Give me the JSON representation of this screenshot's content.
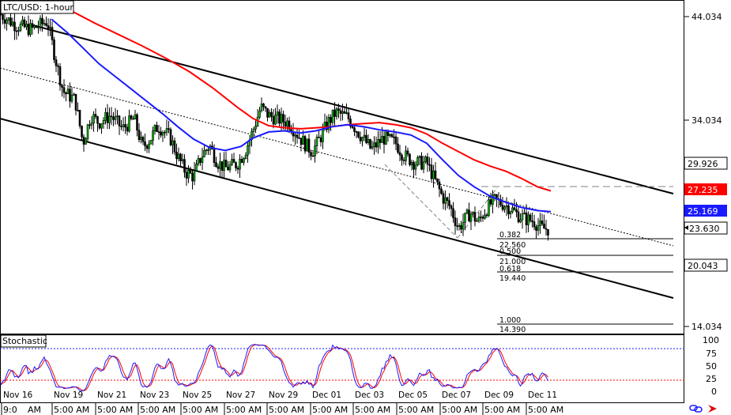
{
  "chart_data": {
    "type": "candlestick",
    "title": "LTC/USD: 1-hour",
    "y_ticks": [
      "44.034",
      "34.034",
      "14.034"
    ],
    "price_tags": [
      {
        "label": "29.926",
        "value": 29.926,
        "bg": "#ffffff",
        "fg": "#000000"
      },
      {
        "label": "27.235",
        "value": 27.235,
        "bg": "#ff0000",
        "fg": "#ffffff"
      },
      {
        "label": "25.169",
        "value": 25.169,
        "bg": "#1a1aff",
        "fg": "#ffffff"
      },
      {
        "label": "23.630",
        "value": 23.63,
        "bg": "#ffffff",
        "fg": "#000000"
      },
      {
        "label": "20.043",
        "value": 20.043,
        "bg": "#ffffff",
        "fg": "#000000"
      }
    ],
    "x_dates": [
      "Nov 16",
      "Nov 19",
      "Nov 21",
      "Nov 23",
      "Nov 25",
      "Nov 27",
      "Nov 29",
      "Dec 01",
      "Dec 03",
      "Dec 05",
      "Dec 07",
      "Dec 09",
      "Dec 11"
    ],
    "x_times": [
      "9:0",
      "AM",
      "5:00 AM",
      "5:00 AM",
      "5:00 AM",
      "5:00 AM",
      "5:00 AM",
      "5:00 AM",
      "5:00 AM",
      "5:00 AM",
      "5:00 AM",
      "5:00 AM",
      "5:00 AM",
      "5:00 AM"
    ],
    "fib_levels": [
      {
        "ratio": "0.382",
        "price": "22.560"
      },
      {
        "ratio": "0.500",
        "price": "21.000"
      },
      {
        "ratio": "0.618",
        "price": "19.440"
      },
      {
        "ratio": "1.000",
        "price": "14.390"
      }
    ],
    "close_path": [
      [
        0,
        44.3
      ],
      [
        20,
        43.2
      ],
      [
        40,
        42.8
      ],
      [
        60,
        43.6
      ],
      [
        70,
        40
      ],
      [
        80,
        36.8
      ],
      [
        95,
        36
      ],
      [
        105,
        31.8
      ],
      [
        115,
        34.5
      ],
      [
        125,
        33.8
      ],
      [
        140,
        34.5
      ],
      [
        155,
        33.2
      ],
      [
        170,
        34.2
      ],
      [
        180,
        31.4
      ],
      [
        190,
        32.2
      ],
      [
        200,
        33.5
      ],
      [
        215,
        32.4
      ],
      [
        225,
        30.5
      ],
      [
        235,
        29
      ],
      [
        245,
        28.6
      ],
      [
        255,
        30.6
      ],
      [
        265,
        31.6
      ],
      [
        275,
        30
      ],
      [
        285,
        29.4
      ],
      [
        300,
        29.8
      ],
      [
        310,
        31
      ],
      [
        320,
        33
      ],
      [
        330,
        35.3
      ],
      [
        340,
        34.5
      ],
      [
        350,
        34.2
      ],
      [
        365,
        33.8
      ],
      [
        375,
        32.8
      ],
      [
        385,
        31.8
      ],
      [
        395,
        31
      ],
      [
        405,
        32.3
      ],
      [
        415,
        33.8
      ],
      [
        425,
        34.8
      ],
      [
        440,
        34.3
      ],
      [
        455,
        32.7
      ],
      [
        470,
        31.2
      ],
      [
        485,
        32.3
      ],
      [
        500,
        31.9
      ],
      [
        510,
        30.7
      ],
      [
        525,
        29.9
      ],
      [
        540,
        29.9
      ],
      [
        550,
        28.3
      ],
      [
        560,
        26.6
      ],
      [
        570,
        25.6
      ],
      [
        580,
        23.6
      ],
      [
        595,
        25.1
      ],
      [
        605,
        24.2
      ],
      [
        615,
        25.4
      ],
      [
        625,
        26.3
      ],
      [
        635,
        26
      ],
      [
        645,
        25.6
      ],
      [
        655,
        24.9
      ],
      [
        665,
        24.5
      ],
      [
        675,
        24.3
      ],
      [
        685,
        23.6
      ],
      [
        695,
        23.5
      ]
    ],
    "sma_blue": [
      [
        65,
        43.8
      ],
      [
        85,
        42.5
      ],
      [
        105,
        41
      ],
      [
        125,
        39.5
      ],
      [
        145,
        38.3
      ],
      [
        165,
        37.1
      ],
      [
        185,
        35.9
      ],
      [
        205,
        34.7
      ],
      [
        225,
        33.4
      ],
      [
        245,
        32.2
      ],
      [
        265,
        31.4
      ],
      [
        285,
        31.1
      ],
      [
        305,
        31.5
      ],
      [
        320,
        32.3
      ],
      [
        340,
        32.9
      ],
      [
        360,
        33
      ],
      [
        380,
        32.8
      ],
      [
        400,
        33
      ],
      [
        420,
        33.4
      ],
      [
        440,
        33.6
      ],
      [
        460,
        33.4
      ],
      [
        480,
        33.1
      ],
      [
        500,
        32.9
      ],
      [
        520,
        32.6
      ],
      [
        540,
        31.8
      ],
      [
        560,
        30.2
      ],
      [
        580,
        28.7
      ],
      [
        600,
        27.6
      ],
      [
        620,
        26.7
      ],
      [
        640,
        26.1
      ],
      [
        660,
        25.6
      ],
      [
        680,
        25.3
      ],
      [
        697,
        25.2
      ]
    ],
    "sma_red": [
      [
        90,
        44.6
      ],
      [
        120,
        43.4
      ],
      [
        150,
        42.3
      ],
      [
        180,
        41.2
      ],
      [
        210,
        40
      ],
      [
        240,
        38.7
      ],
      [
        270,
        37.1
      ],
      [
        300,
        35.3
      ],
      [
        320,
        34.2
      ],
      [
        340,
        33.5
      ],
      [
        360,
        33.3
      ],
      [
        380,
        33.2
      ],
      [
        400,
        33.3
      ],
      [
        420,
        33.4
      ],
      [
        440,
        33.6
      ],
      [
        460,
        33.7
      ],
      [
        480,
        33.8
      ],
      [
        500,
        33.6
      ],
      [
        520,
        33.3
      ],
      [
        540,
        32.7
      ],
      [
        560,
        31.8
      ],
      [
        580,
        31
      ],
      [
        600,
        30.2
      ],
      [
        620,
        29.6
      ],
      [
        640,
        29.1
      ],
      [
        660,
        28.4
      ],
      [
        680,
        27.6
      ],
      [
        697,
        27.2
      ]
    ],
    "stochastic": {
      "label": "Stochastic",
      "y_ticks": [
        "100",
        "75",
        "50",
        "25",
        "0"
      ],
      "levels": [
        80,
        20
      ]
    }
  }
}
